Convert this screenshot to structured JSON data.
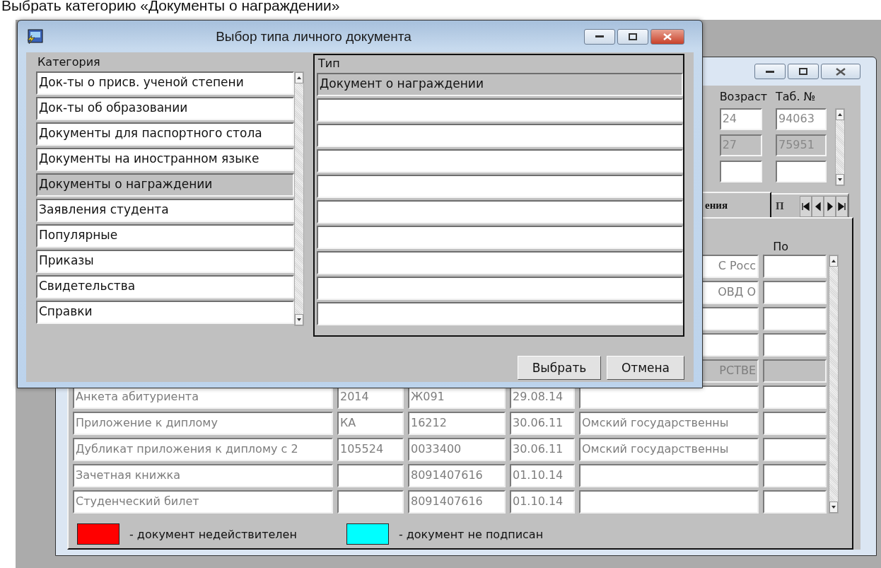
{
  "caption": "Выбрать категорию «Документы о награждении»",
  "background_window": {
    "columns": [
      "Возраст",
      "Таб. №"
    ],
    "person_rows": [
      {
        "age": "24",
        "tab_number": "94063",
        "selected": false
      },
      {
        "age": "27",
        "tab_number": "75951",
        "selected": true
      },
      {
        "selected": false
      }
    ],
    "tabs": [
      {
        "label": "ения",
        "selected": true
      },
      {
        "label": "П",
        "selected": false
      }
    ],
    "po_header": "По",
    "documents": [
      {
        "issuer": "С Росс",
        "selected": false
      },
      {
        "issuer": "ОВД О",
        "selected": false
      },
      {
        "selected": false
      },
      {
        "selected": false
      },
      {
        "issuer": "РСТВЕ",
        "selected": true
      },
      {
        "name": "Анкета абитуриента",
        "series": "2014",
        "number": "Ж091",
        "date": "29.08.14",
        "selected": false
      },
      {
        "name": "Приложение к диплому",
        "series": "КА",
        "number": "16212",
        "date": "30.06.11",
        "issuer": "Омский государственны",
        "selected": false
      },
      {
        "name": "Дубликат приложения к диплому с 2",
        "series": "105524",
        "number": "0033400",
        "date": "30.06.11",
        "issuer": "Омский государственны",
        "selected": false
      },
      {
        "name": "Зачетная книжка",
        "number": "8091407616",
        "date": "01.10.14",
        "selected": false
      },
      {
        "name": "Студенческий билет",
        "number": "8091407616",
        "date": "01.10.14",
        "selected": false
      }
    ],
    "legend": [
      {
        "color": "#ff0000",
        "label": "- документ недействителен"
      },
      {
        "color": "#00ffff",
        "label": "- документ не подписан"
      }
    ]
  },
  "dialog": {
    "title": "Выбор типа личного документа",
    "category_header": "Категория",
    "categories": [
      {
        "label": "Док-ты о присв. ученой степени",
        "selected": false
      },
      {
        "label": "Док-ты об образовании",
        "selected": false
      },
      {
        "label": "Документы для паспортного стола",
        "selected": false
      },
      {
        "label": "Документы на иностранном языке",
        "selected": false
      },
      {
        "label": "Документы о награждении",
        "selected": true
      },
      {
        "label": "Заявления студента",
        "selected": false
      },
      {
        "label": "Популярные",
        "selected": false
      },
      {
        "label": "Приказы",
        "selected": false
      },
      {
        "label": "Свидетельства",
        "selected": false
      },
      {
        "label": "Справки",
        "selected": false
      }
    ],
    "type_header": "Тип",
    "types": [
      {
        "label": "Документ о награждении",
        "selected": true
      }
    ],
    "buttons": [
      "Выбрать",
      "Отмена"
    ]
  }
}
